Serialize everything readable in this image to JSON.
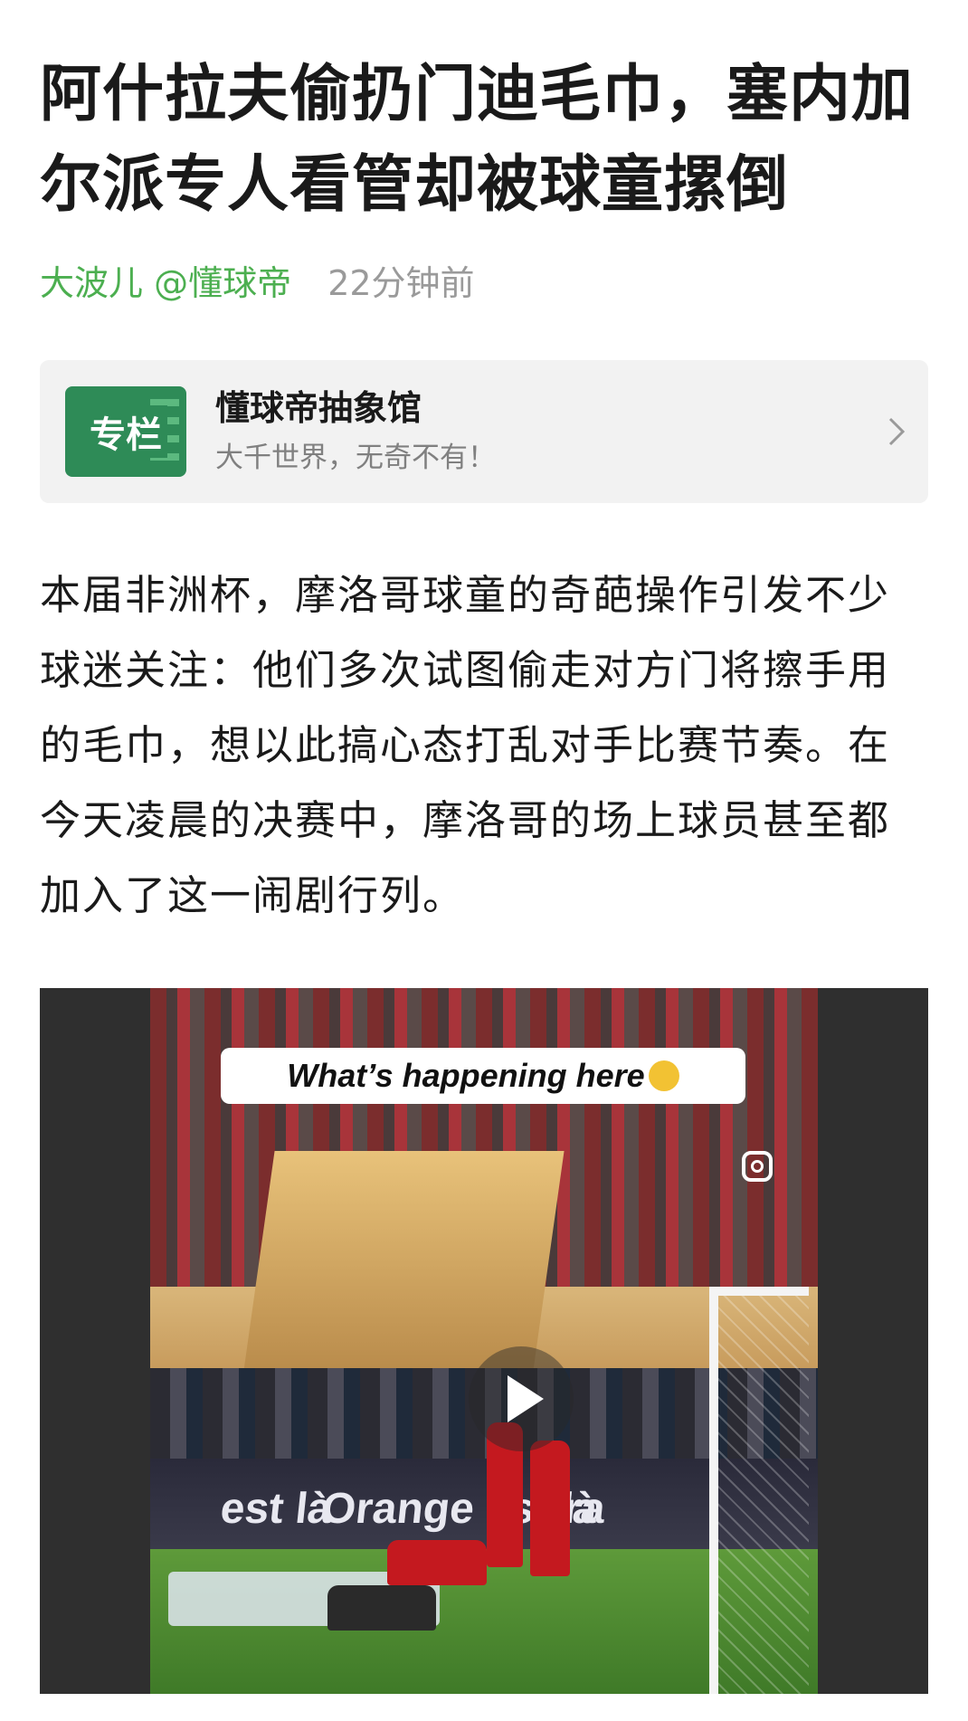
{
  "article": {
    "title": "阿什拉夫偷扔门迪毛巾，塞内加尔派专人看管却被球童摞倒",
    "author": "大波儿 @懂球帝",
    "time": "22分钟前"
  },
  "column": {
    "logo_text": "专栏",
    "name": "懂球帝抽象馆",
    "desc": "大千世界，无奇不有！"
  },
  "body": {
    "paragraph": "本届非洲杯，摩洛哥球童的奇葩操作引发不少球迷关注：他们多次试图偷走对方门将擦手用的毛巾，想以此搞心态打乱对手比赛节奏。在今天凌晨的决赛中，摩洛哥的场上球员甚至都加入了这一闹剧行列。"
  },
  "video": {
    "caption": "What’s happening here",
    "boards": [
      "est là",
      "Orange est là",
      "Ora"
    ],
    "icons": [
      "instagram-icon",
      "play-icon",
      "chevron-right-icon"
    ]
  },
  "colors": {
    "author": "#4caf50",
    "muted": "#9a9a9a",
    "card_bg": "#f2f2f2",
    "logo_green": "#2e8b57"
  }
}
